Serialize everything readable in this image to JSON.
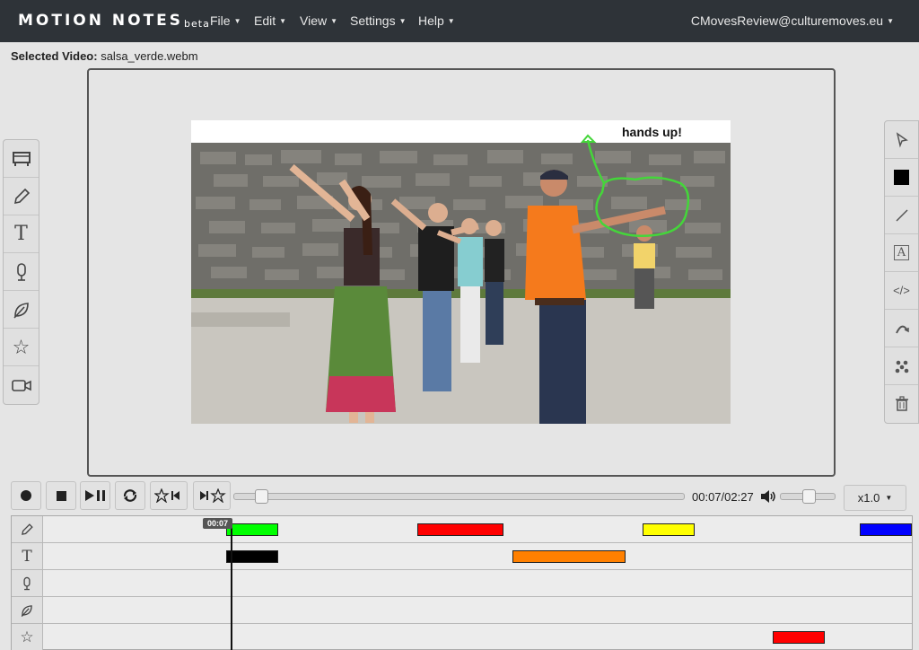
{
  "navbar": {
    "brand": "MOTION NOTES",
    "brand_suffix": "beta",
    "menus": [
      "File",
      "Edit",
      "View",
      "Settings",
      "Help"
    ],
    "user": "CMovesReview@culturemoves.eu"
  },
  "selected_video": {
    "label": "Selected Video:",
    "value": "salsa_verde.webm"
  },
  "video": {
    "caption": "hands up!"
  },
  "left_toolbar": [
    "storyboard-icon",
    "pencil-icon",
    "text-icon",
    "microphone-icon",
    "leaf-icon",
    "star-icon",
    "video-camera-icon"
  ],
  "right_toolbar": [
    "pointer-icon",
    "color-swatch-icon",
    "line-icon",
    "text-box-icon",
    "code-icon",
    "curve-icon",
    "dots-icon",
    "trash-icon"
  ],
  "controls": {
    "time": "00:07/02:27",
    "speed": "x1.0",
    "seek_fraction": 0.048,
    "volume_fraction": 0.5
  },
  "timeline": {
    "playhead_label": "00:07",
    "tracks": [
      {
        "icon": "pencil-icon",
        "clips": [
          {
            "start": 0.21,
            "end": 0.27,
            "color": "#00ff00"
          },
          {
            "start": 0.43,
            "end": 0.53,
            "color": "#ff0000"
          },
          {
            "start": 0.69,
            "end": 0.75,
            "color": "#ffff00"
          },
          {
            "start": 0.94,
            "end": 1.0,
            "color": "#0000ff"
          }
        ]
      },
      {
        "icon": "text-icon",
        "clips": [
          {
            "start": 0.21,
            "end": 0.27,
            "color": "#000000"
          },
          {
            "start": 0.54,
            "end": 0.67,
            "color": "#ff8000"
          }
        ]
      },
      {
        "icon": "microphone-icon",
        "clips": []
      },
      {
        "icon": "leaf-icon",
        "clips": []
      },
      {
        "icon": "star-icon",
        "clips": [
          {
            "start": 0.84,
            "end": 0.9,
            "color": "#ff0000"
          }
        ]
      }
    ]
  }
}
